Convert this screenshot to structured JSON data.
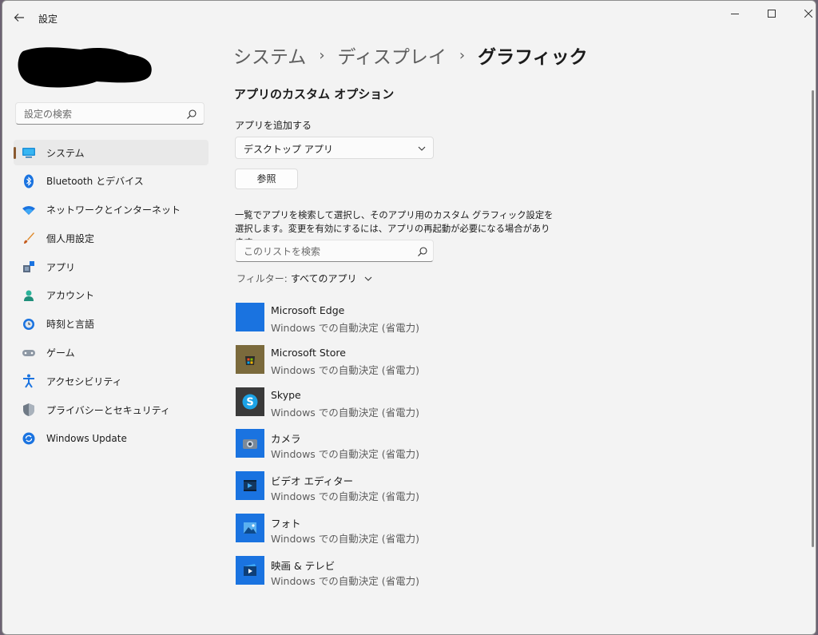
{
  "window": {
    "title": "設定"
  },
  "sidebar": {
    "search_placeholder": "設定の検索",
    "items": [
      {
        "label": "システム",
        "icon": "system-icon",
        "active": true
      },
      {
        "label": "Bluetooth とデバイス",
        "icon": "bluetooth-icon"
      },
      {
        "label": "ネットワークとインターネット",
        "icon": "wifi-icon"
      },
      {
        "label": "個人用設定",
        "icon": "brush-icon"
      },
      {
        "label": "アプリ",
        "icon": "apps-icon"
      },
      {
        "label": "アカウント",
        "icon": "person-icon"
      },
      {
        "label": "時刻と言語",
        "icon": "globe-clock-icon"
      },
      {
        "label": "ゲーム",
        "icon": "gamepad-icon"
      },
      {
        "label": "アクセシビリティ",
        "icon": "accessibility-icon"
      },
      {
        "label": "プライバシーとセキュリティ",
        "icon": "shield-icon"
      },
      {
        "label": "Windows Update",
        "icon": "update-icon"
      }
    ]
  },
  "breadcrumb": {
    "items": [
      "システム",
      "ディスプレイ"
    ],
    "current": "グラフィック",
    "separator": "›"
  },
  "main": {
    "section_title": "アプリのカスタム オプション",
    "add_app_label": "アプリを追加する",
    "app_type_selected": "デスクトップ アプリ",
    "browse_label": "参照",
    "description": "一覧でアプリを検索して選択し、そのアプリ用のカスタム グラフィック設定を選択します。変更を有効にするには、アプリの再起動が必要になる場合があります。",
    "list_search_placeholder": "このリストを検索",
    "filter_label": "フィルター:",
    "filter_value": "すべてのアプリ"
  },
  "apps": [
    {
      "name": "Microsoft Edge",
      "status": "Windows での自動決定 (省電力)",
      "icon": "edge-icon",
      "color": "#1a73e0"
    },
    {
      "name": "Microsoft Store",
      "status": "Windows での自動決定 (省電力)",
      "icon": "store-icon",
      "color": "#7b6a3c"
    },
    {
      "name": "Skype",
      "status": "Windows での自動決定 (省電力)",
      "icon": "skype-icon",
      "color": "#3a3a3a"
    },
    {
      "name": "カメラ",
      "status": "Windows での自動決定 (省電力)",
      "icon": "camera-icon",
      "color": "#1a73e0"
    },
    {
      "name": "ビデオ エディター",
      "status": "Windows での自動決定 (省電力)",
      "icon": "video-editor-icon",
      "color": "#1a73e0"
    },
    {
      "name": "フォト",
      "status": "Windows での自動決定 (省電力)",
      "icon": "photos-icon",
      "color": "#1a73e0"
    },
    {
      "name": "映画 & テレビ",
      "status": "Windows での自動決定 (省電力)",
      "icon": "movies-tv-icon",
      "color": "#1a73e0"
    }
  ],
  "colors": {
    "accent": "#8a5a30",
    "window_bg": "#f3f3f3",
    "app_tile_blue": "#1a73e0"
  }
}
